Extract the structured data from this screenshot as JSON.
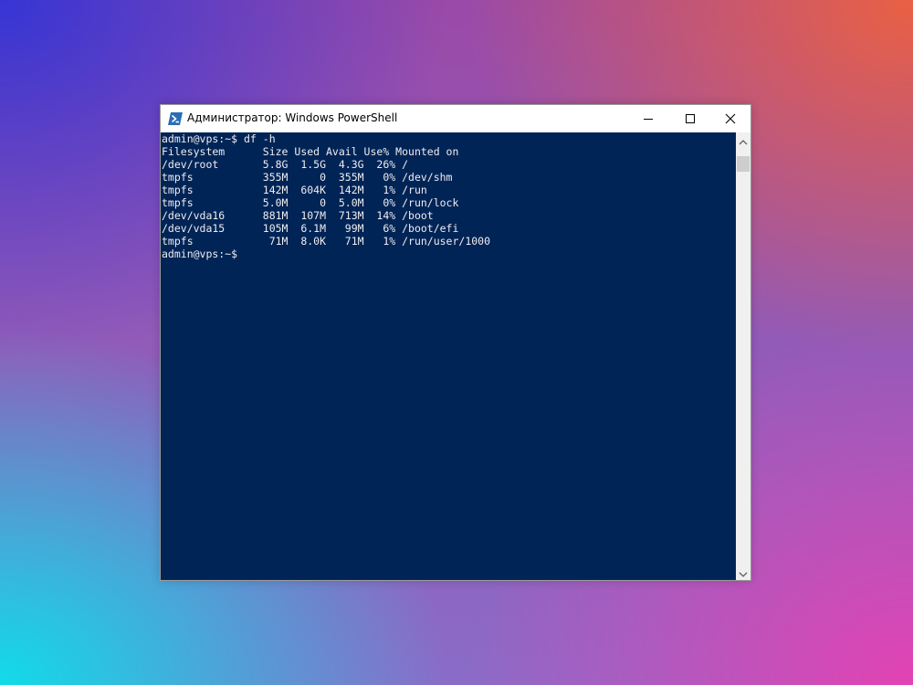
{
  "window": {
    "title": "Администратор: Windows PowerShell",
    "icon": "powershell-icon"
  },
  "controls": {
    "minimize_icon": "minimize-icon",
    "maximize_icon": "maximize-icon",
    "close_icon": "close-icon"
  },
  "console": {
    "background": "#012456",
    "foreground": "#eeedf0",
    "prompt": "admin@vps:~$",
    "command": "df -h",
    "header": [
      "Filesystem",
      "Size",
      "Used",
      "Avail",
      "Use%",
      "Mounted on"
    ],
    "rows": [
      [
        "/dev/root",
        "5.8G",
        "1.5G",
        "4.3G",
        "26%",
        "/"
      ],
      [
        "tmpfs",
        "355M",
        "0",
        "355M",
        "0%",
        "/dev/shm"
      ],
      [
        "tmpfs",
        "142M",
        "604K",
        "142M",
        "1%",
        "/run"
      ],
      [
        "tmpfs",
        "5.0M",
        "0",
        "5.0M",
        "0%",
        "/run/lock"
      ],
      [
        "/dev/vda16",
        "881M",
        "107M",
        "713M",
        "14%",
        "/boot"
      ],
      [
        "/dev/vda15",
        "105M",
        "6.1M",
        "99M",
        "6%",
        "/boot/efi"
      ],
      [
        "tmpfs",
        "71M",
        "8.0K",
        "71M",
        "1%",
        "/run/user/1000"
      ]
    ],
    "final_prompt": "admin@vps:~$"
  },
  "scrollbar": {
    "up_icon": "scroll-up-arrow-icon",
    "down_icon": "scroll-down-arrow-icon"
  }
}
